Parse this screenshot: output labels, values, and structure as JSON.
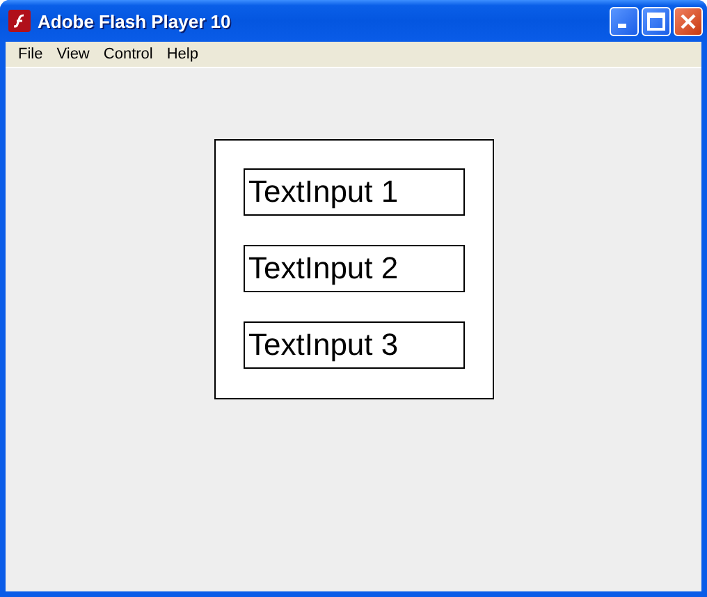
{
  "window": {
    "title": "Adobe Flash Player 10"
  },
  "menu": [
    "File",
    "View",
    "Control",
    "Help"
  ],
  "fields": [
    {
      "value": "TextInput 1"
    },
    {
      "value": "TextInput 2"
    },
    {
      "value": "TextInput 3"
    }
  ]
}
